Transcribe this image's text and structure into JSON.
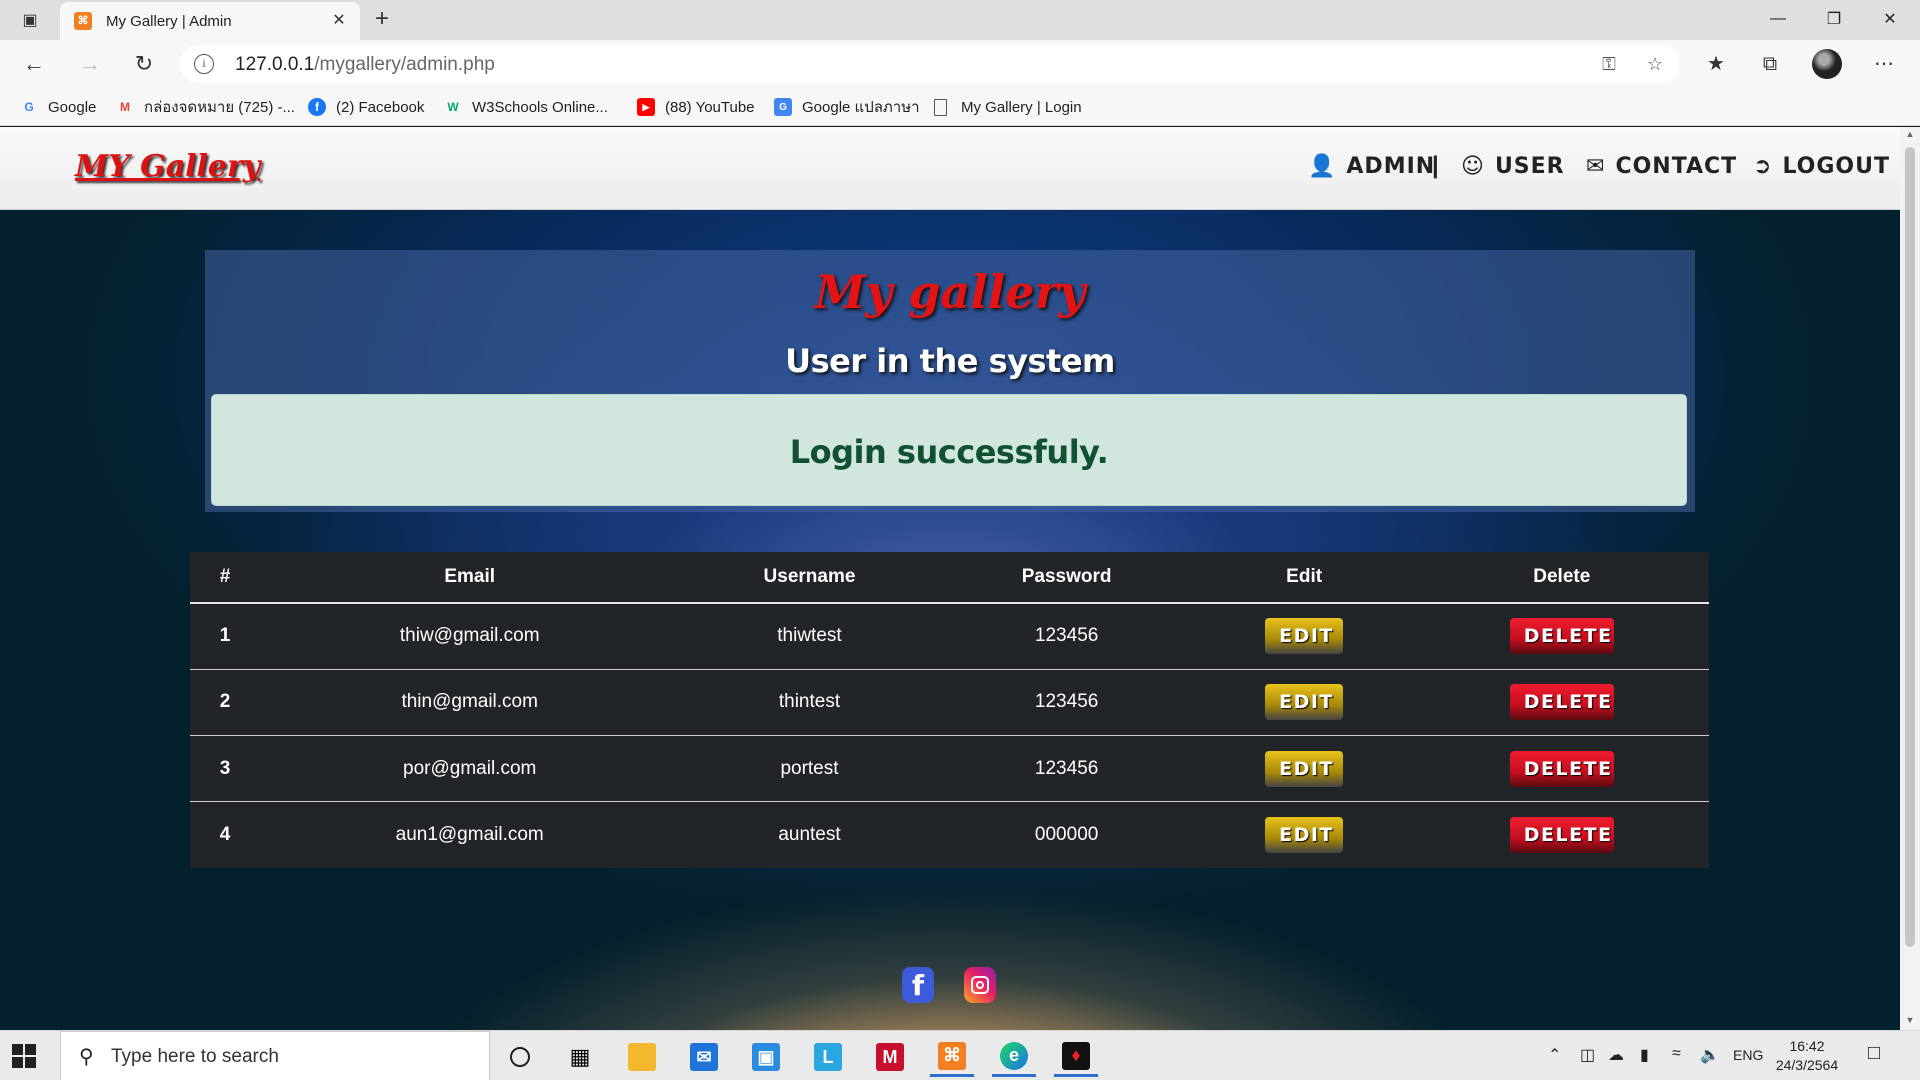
{
  "browser": {
    "tab_title": "My Gallery | Admin",
    "url_host": "127.0.0.1",
    "url_path": "/mygallery/admin.php",
    "bookmarks": [
      {
        "label": "Google",
        "icon": "google-icon",
        "color": "#4285f4"
      },
      {
        "label": "กล่องจดหมาย (725) -...",
        "icon": "gmail-icon",
        "color": "#ea4335"
      },
      {
        "label": "(2) Facebook",
        "icon": "facebook-icon",
        "color": "#1877f2"
      },
      {
        "label": "W3Schools Online...",
        "icon": "w3schools-icon",
        "color": "#04aa6d"
      },
      {
        "label": "(88) YouTube",
        "icon": "youtube-icon",
        "color": "#ff0000"
      },
      {
        "label": "Google แปลภาษา",
        "icon": "google-translate-icon",
        "color": "#4285f4"
      },
      {
        "label": "My Gallery | Login",
        "icon": "page-icon",
        "color": "#555555"
      }
    ]
  },
  "site": {
    "logo": "MY Gallery",
    "nav": {
      "admin": "ADMIN",
      "separator": "|",
      "user": "USER",
      "contact": "CONTACT",
      "logout": "LOGOUT"
    },
    "hero_title": "My gallery",
    "hero_subtitle": "User in the system",
    "alert": "Login successfuly."
  },
  "table": {
    "headers": [
      "#",
      "Email",
      "Username",
      "Password",
      "Edit",
      "Delete"
    ],
    "rows": [
      {
        "num": "1",
        "email": "thiw@gmail.com",
        "username": "thiwtest",
        "password": "123456"
      },
      {
        "num": "2",
        "email": "thin@gmail.com",
        "username": "thintest",
        "password": "123456"
      },
      {
        "num": "3",
        "email": "por@gmail.com",
        "username": "portest",
        "password": "123456"
      },
      {
        "num": "4",
        "email": "aun1@gmail.com",
        "username": "auntest",
        "password": "000000"
      }
    ],
    "edit_label": "EDIT",
    "delete_label": "DELETE"
  },
  "taskbar": {
    "search_placeholder": "Type here to search",
    "language": "ENG",
    "time": "16:42",
    "date": "24/3/2564"
  },
  "colors": {
    "alert_bg": "#d1e7dd",
    "alert_text": "#0f5132",
    "table_bg": "#212529",
    "edit_btn": "#d4af0c",
    "delete_btn": "#dc1628",
    "logo": "#dd1111"
  }
}
